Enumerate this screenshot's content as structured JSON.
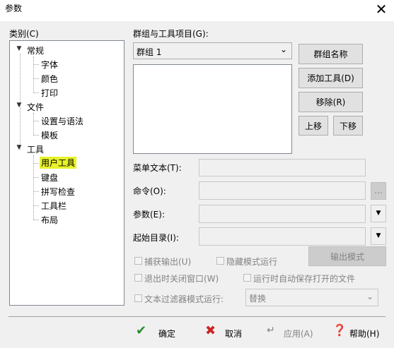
{
  "window": {
    "title": "参数",
    "close_glyph": "✕"
  },
  "category": {
    "label": "类别(C)",
    "tree": [
      {
        "label": "常规",
        "children": [
          "字体",
          "颜色",
          "打印"
        ]
      },
      {
        "label": "文件",
        "children": [
          "设置与语法",
          "模板"
        ]
      },
      {
        "label": "工具",
        "children": [
          "用户工具",
          "键盘",
          "拼写检查",
          "工具栏",
          "布局"
        ]
      }
    ],
    "selected": "用户工具"
  },
  "groups": {
    "label": "群组与工具项目(G):",
    "selected": "群组 1"
  },
  "buttons": {
    "group_name": "群组名称",
    "add_tool": "添加工具(D)",
    "remove": "移除(R)",
    "move_up": "上移",
    "move_down": "下移",
    "output_mode": "输出模式",
    "browse": "..."
  },
  "fields": {
    "menu_text": "菜单文本(T):",
    "command": "命令(O):",
    "args": "参数(E):",
    "init_dir": "起始目录(I):"
  },
  "options": {
    "capture_output": "捕获输出(U)",
    "hidden_mode": "隐藏模式运行",
    "close_on_exit": "退出时关闭窗口(W)",
    "autosave": "运行时自动保存打开的文件",
    "text_filter": "文本过滤器模式运行:",
    "filter_value": "替换"
  },
  "footer": {
    "ok": "确定",
    "cancel": "取消",
    "apply": "应用(A)",
    "help": "帮助(H)"
  },
  "colors": {
    "selection_highlight": "#e8f22a",
    "ok_green": "#2e8b2e",
    "cancel_red": "#cc2222"
  }
}
